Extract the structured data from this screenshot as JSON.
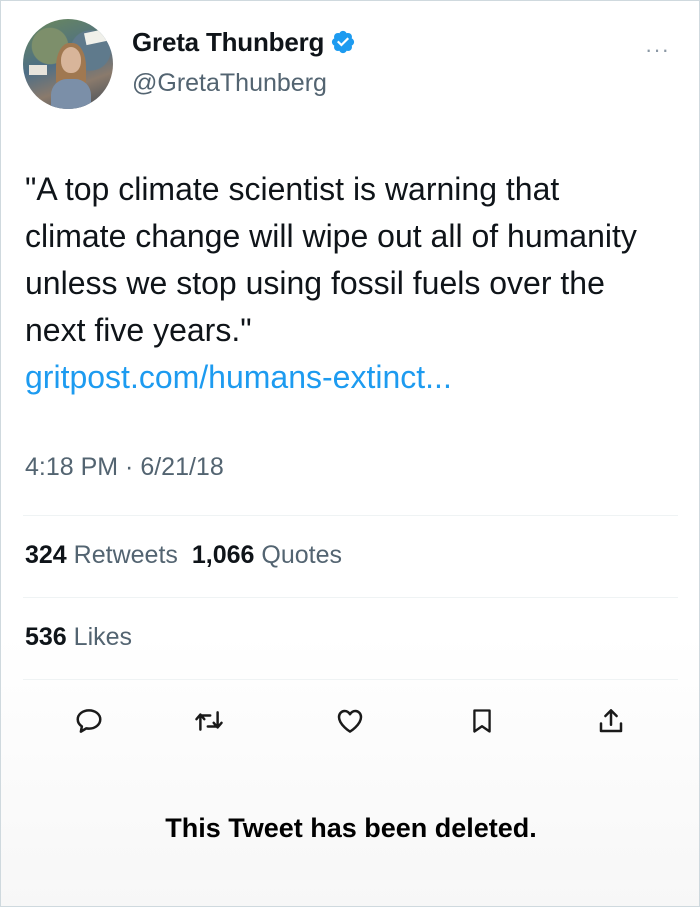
{
  "author": {
    "name": "Greta Thunberg",
    "handle": "@GretaThunberg",
    "verified_icon": "verified-badge-icon",
    "avatar_icon": "profile-photo"
  },
  "more_label": "···",
  "tweet": {
    "text": "\"A top climate scientist is warning that climate change will wipe out all of humanity unless we stop using fossil fuels over the next five years.\"",
    "link": "gritpost.com/humans-extinct...",
    "timestamp": "4:18 PM · 6/21/18"
  },
  "stats": {
    "retweets_count": "324",
    "retweets_label": "Retweets",
    "quotes_count": "1,066",
    "quotes_label": "Quotes",
    "likes_count": "536",
    "likes_label": "Likes"
  },
  "actions": [
    "reply-icon",
    "retweet-icon",
    "like-icon",
    "bookmark-icon",
    "share-icon"
  ],
  "status_message": "This Tweet has been deleted.",
  "colors": {
    "link": "#1d9bf0",
    "secondary_text": "#536471",
    "primary_text": "#0f1419",
    "verified": "#1d9bf0"
  }
}
